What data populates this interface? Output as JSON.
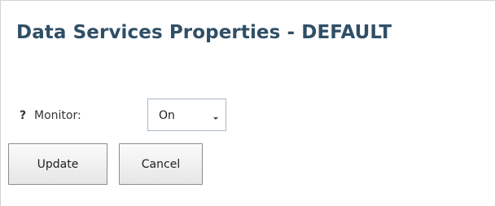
{
  "header": {
    "title": "Data Services Properties - DEFAULT"
  },
  "form": {
    "help_symbol": "?",
    "monitor_label": "Monitor:",
    "monitor_value": "On"
  },
  "actions": {
    "update_label": "Update",
    "cancel_label": "Cancel"
  },
  "colors": {
    "title": "#2f4f66",
    "border": "#d4d4d4",
    "select_border": "#a8b8c8"
  }
}
